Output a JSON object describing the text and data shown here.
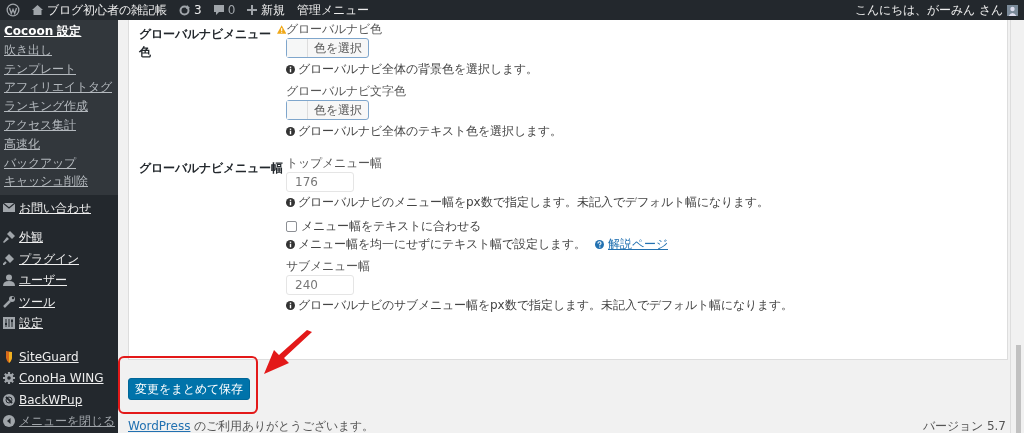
{
  "admin_bar": {
    "site_name": "ブログ初心者の雑記帳",
    "updates": "3",
    "comments": "0",
    "new_label": "新規",
    "admin_menu": "管理メニュー",
    "greeting": "こんにちは、がーみん さん"
  },
  "sidebar": {
    "submenu": [
      {
        "label": "Cocoon 設定",
        "selected": true
      },
      {
        "label": "吹き出し",
        "selected": false
      },
      {
        "label": "テンプレート",
        "selected": false
      },
      {
        "label": "アフィリエイトタグ",
        "selected": false
      },
      {
        "label": "ランキング作成",
        "selected": false
      },
      {
        "label": "アクセス集計",
        "selected": false
      },
      {
        "label": "高速化",
        "selected": false
      },
      {
        "label": "バックアップ",
        "selected": false
      },
      {
        "label": "キャッシュ削除",
        "selected": false
      }
    ],
    "menu": [
      {
        "label": "お問い合わせ",
        "kind": "envelope"
      },
      {
        "label": "外観",
        "kind": "brush"
      },
      {
        "label": "プラグイン",
        "kind": "plug"
      },
      {
        "label": "ユーザー",
        "kind": "user"
      },
      {
        "label": "ツール",
        "kind": "wrench"
      },
      {
        "label": "設定",
        "kind": "sliders"
      },
      {
        "label": "SiteGuard",
        "kind": "shield"
      },
      {
        "label": "ConoHa WING",
        "kind": "gear"
      },
      {
        "label": "BackWPup",
        "kind": "disc"
      }
    ],
    "collapse": "メニューを閉じる"
  },
  "settings": [
    {
      "label": "グローバルナビメニュー色",
      "warning": true,
      "fields": [
        {
          "kind": "color",
          "label": "グローバルナビ色",
          "button": "色を選択",
          "help": "グローバルナビ全体の背景色を選択します。"
        },
        {
          "kind": "color",
          "label": "グローバルナビ文字色",
          "button": "色を選択",
          "help": "グローバルナビ全体のテキスト色を選択します。"
        }
      ]
    },
    {
      "label": "グローバルナビメニュー幅",
      "warning": false,
      "fields": [
        {
          "kind": "number",
          "label": "トップメニュー幅",
          "value": "176",
          "help": "グローバルナビのメニュー幅をpx数で指定します。未記入でデフォルト幅になります。"
        },
        {
          "kind": "checkbox",
          "label": "メニュー幅をテキストに合わせる",
          "checked": false,
          "help": "メニュー幅を均一にせずにテキスト幅で設定します。",
          "link": "解説ページ"
        },
        {
          "kind": "number",
          "label": "サブメニュー幅",
          "value": "240",
          "help": "グローバルナビのサブメニュー幅をpx数で指定します。未記入でデフォルト幅になります。"
        }
      ]
    }
  ],
  "save_button": "変更をまとめて保存",
  "footer": {
    "link": "WordPress",
    "text": "のご利用ありがとうございます。",
    "version": "バージョン 5.7"
  }
}
